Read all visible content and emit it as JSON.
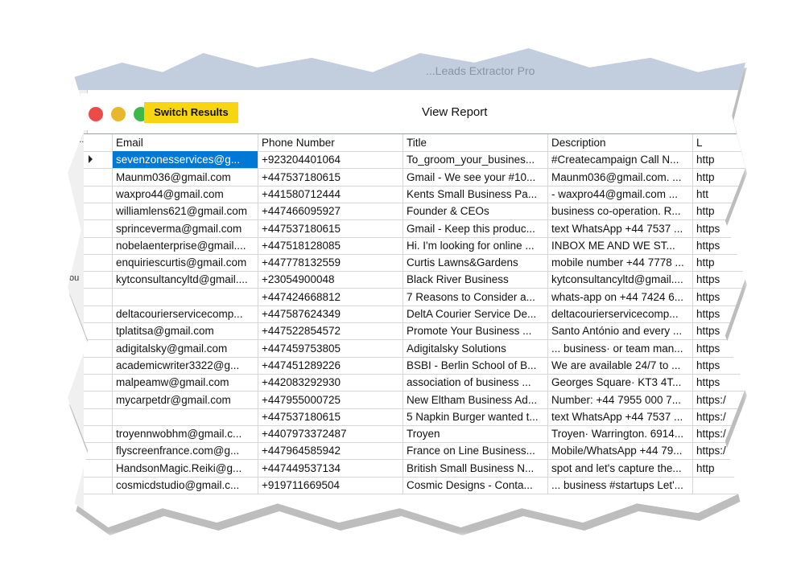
{
  "background_window": {
    "title": "...Leads Extractor Pro"
  },
  "side_panel": {
    "labels": [
      "ep..",
      "..",
      "ou",
      "e"
    ]
  },
  "window": {
    "traffic_lights": {
      "close_color": "#ed4a4a",
      "minimize_color": "#e8b82b",
      "maximize_color": "#3fb84a"
    },
    "switch_button": "Switch Results",
    "title": "View Report"
  },
  "table": {
    "columns": [
      "Email",
      "Phone Number",
      "Title",
      "Description",
      "L"
    ],
    "rows": [
      {
        "email": "sevenzonesservices@g...",
        "phone": "+923204401064",
        "title": "To_groom_your_busines...",
        "description": "#Createcampaign Call N...",
        "link": "http"
      },
      {
        "email": "Maunm036@gmail.com",
        "phone": "+447537180615",
        "title": "Gmail - We see your #10...",
        "description": "Maunm036@gmail.com. ...",
        "link": "http"
      },
      {
        "email": "waxpro44@gmail.com",
        "phone": "+441580712444",
        "title": "Kents Small Business Pa...",
        "description": "- waxpro44@gmail.com ...",
        "link": "htt"
      },
      {
        "email": "williamlens621@gmail.com",
        "phone": "+447466095927",
        "title": "Founder & CEOs",
        "description": "business co-operation. R...",
        "link": "http"
      },
      {
        "email": "sprinceverma@gmail.com",
        "phone": "+447537180615",
        "title": "Gmail - Keep this produc...",
        "description": "text WhatsApp +44 7537 ...",
        "link": "https"
      },
      {
        "email": "nobelaenterprise@gmail....",
        "phone": "+447518128085",
        "title": "Hi. I'm looking for online ...",
        "description": "INBOX ME AND WE ST...",
        "link": "https"
      },
      {
        "email": "enquiriescurtis@gmail.com",
        "phone": "+447778132559",
        "title": "Curtis Lawns&Gardens",
        "description": "mobile number +44 7778 ...",
        "link": "http"
      },
      {
        "email": "kytconsultancyltd@gmail....",
        "phone": "+23054900048",
        "title": "Black River Business",
        "description": "kytconsultancyltd@gmail....",
        "link": "https"
      },
      {
        "email": "",
        "phone": "+447424668812",
        "title": "7 Reasons to Consider a...",
        "description": "whats-app on +44 7424 6...",
        "link": "https"
      },
      {
        "email": "deltacourierservicecomp...",
        "phone": "+447587624349",
        "title": "DeltA Courier Service De...",
        "description": "deltacourierservicecomp...",
        "link": "https"
      },
      {
        "email": "tplatitsa@gmail.com",
        "phone": "+447522854572",
        "title": "Promote Your Business ...",
        "description": "Santo António and every ...",
        "link": "https"
      },
      {
        "email": "adigitalsky@gmail.com",
        "phone": "+447459753805",
        "title": "Adigitalsky Solutions",
        "description": "... business· or team man...",
        "link": "https"
      },
      {
        "email": "academicwriter3322@g...",
        "phone": "+447451289226",
        "title": "BSBI - Berlin School of B...",
        "description": "We are available 24/7 to ...",
        "link": "https"
      },
      {
        "email": "malpeamw@gmail.com",
        "phone": "+442083292930",
        "title": "association of business ...",
        "description": "Georges Square· KT3 4T...",
        "link": "https"
      },
      {
        "email": "mycarpetdr@gmail.com",
        "phone": "+447955000725",
        "title": "New Eltham Business Ad...",
        "description": "Number: +44 7955 000 7...",
        "link": "https:/"
      },
      {
        "email": "",
        "phone": "+447537180615",
        "title": "5 Napkin Burger wanted t...",
        "description": "text WhatsApp +44 7537 ...",
        "link": "https:/"
      },
      {
        "email": "troyennwobhm@gmail.c...",
        "phone": "+4407973372487",
        "title": "Troyen",
        "description": "Troyen· Warrington. 6914...",
        "link": "https:/"
      },
      {
        "email": "flyscreenfrance.com@g...",
        "phone": "+447964585942",
        "title": "France on Line Business...",
        "description": "Mobile/WhatsApp +44 79...",
        "link": "https:/"
      },
      {
        "email": "HandsonMagic.Reiki@g...",
        "phone": "+447449537134",
        "title": "British Small Business N...",
        "description": "spot and let's capture the...",
        "link": "http"
      },
      {
        "email": "cosmicdstudio@gmail.c...",
        "phone": "+919711669504",
        "title": "Cosmic Designs - Conta...",
        "description": "... business #startups Let'...",
        "link": ""
      }
    ]
  }
}
